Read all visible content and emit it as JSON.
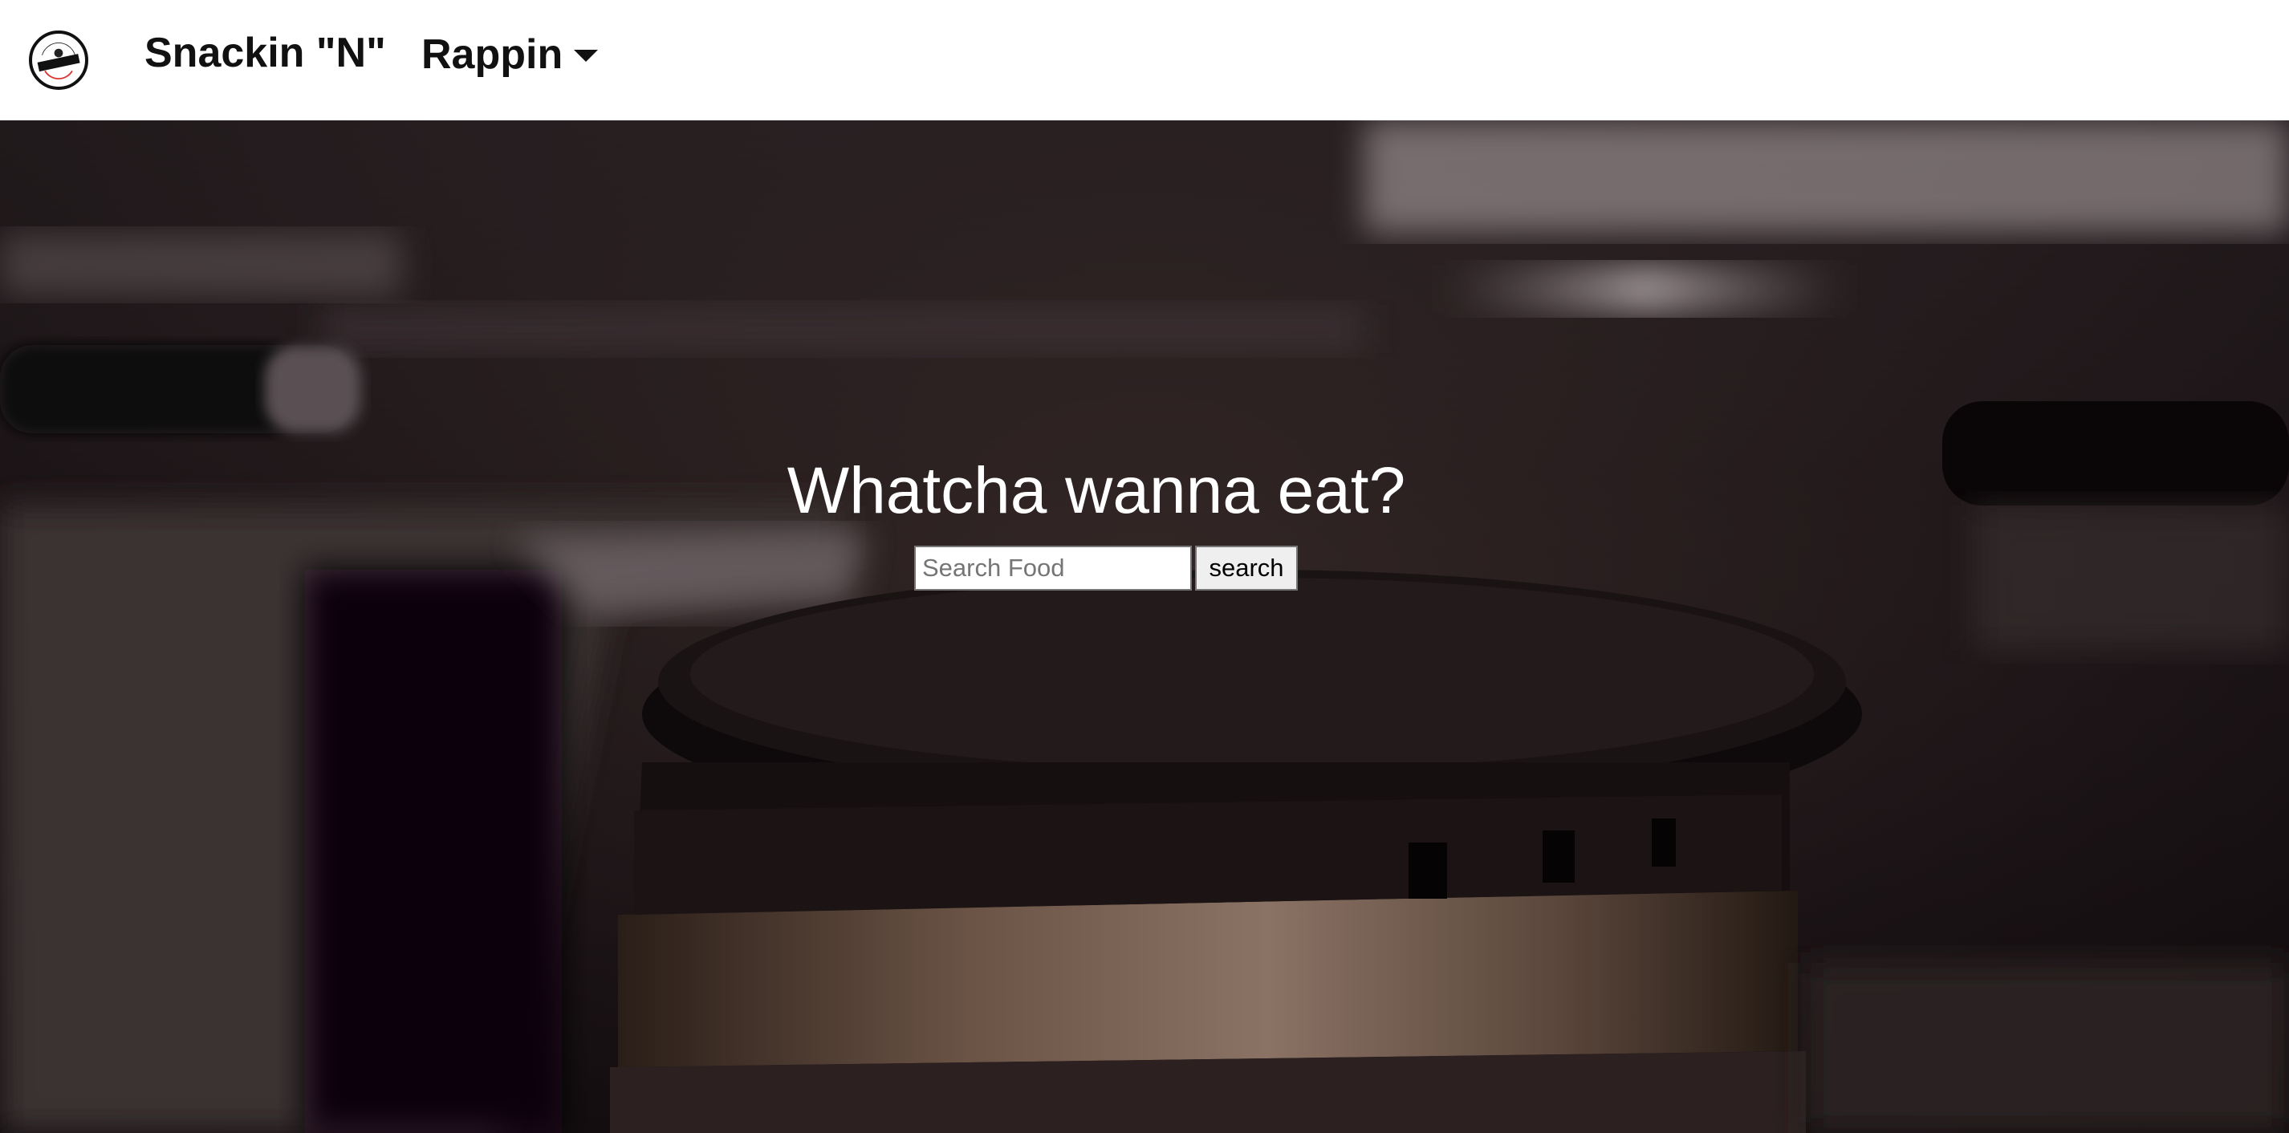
{
  "navbar": {
    "logo": {
      "icon": "rappin-logo-icon",
      "text_top": "SNACKIN",
      "text_banner": "RAPPIN"
    },
    "brand_label": "Snackin \"N\"",
    "dropdown_label": "Rappin"
  },
  "hero": {
    "heading": "Whatcha wanna eat?",
    "search": {
      "placeholder": "Search Food",
      "value": "",
      "button_label": "search"
    },
    "background": "stove-burner-photo"
  },
  "colors": {
    "navbar_bg": "#ffffff",
    "hero_text": "#ffffff",
    "button_bg": "#efefef"
  }
}
